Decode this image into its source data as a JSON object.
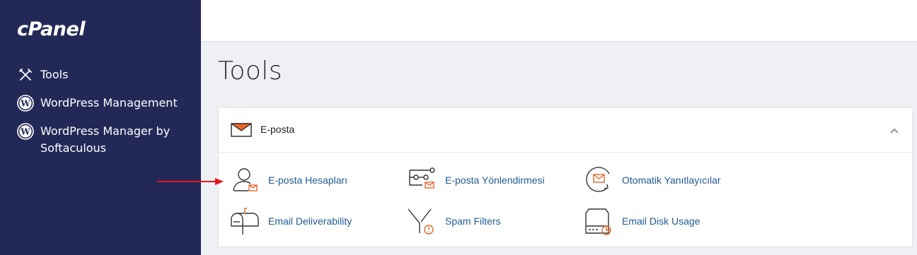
{
  "sidebar": {
    "logo": "cPanel",
    "items": [
      {
        "label": "Tools",
        "icon": "tools-icon"
      },
      {
        "label": "WordPress Management",
        "icon": "wordpress-icon"
      },
      {
        "label": "WordPress Manager by Softaculous",
        "icon": "wordpress-icon"
      }
    ]
  },
  "main": {
    "title": "Tools",
    "section": {
      "title": "E-posta",
      "icon": "envelope-icon",
      "expanded": true,
      "tools": [
        {
          "label": "E-posta Hesapları",
          "icon": "email-accounts-icon"
        },
        {
          "label": "E-posta Yönlendirmesi",
          "icon": "forwarders-icon"
        },
        {
          "label": "Otomatik Yanıtlayıcılar",
          "icon": "autoresponders-icon"
        },
        {
          "label": "Email Deliverability",
          "icon": "mailbox-icon"
        },
        {
          "label": "Spam Filters",
          "icon": "spam-filter-icon"
        },
        {
          "label": "Email Disk Usage",
          "icon": "disk-usage-icon"
        }
      ]
    }
  },
  "colors": {
    "sidebar_bg": "#232957",
    "link": "#1f5a96",
    "accent_orange": "#e8652b",
    "arrow_red": "#e8131c"
  }
}
